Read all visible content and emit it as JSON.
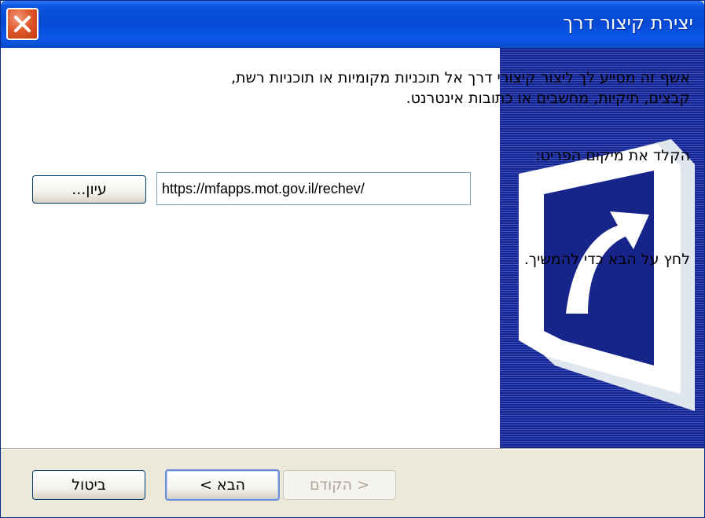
{
  "window": {
    "title": "יצירת קיצור דרך",
    "close_icon": "close-icon"
  },
  "main": {
    "intro_text": "אשף זה מסייע לך ליצור קיצורי דרך אל תוכניות מקומיות או תוכניות רשת, קבצים, תיקיות, מחשבים או כתובות אינטרנט.",
    "location_label": "הקלד את מיקום הפריט:",
    "location_value": "https://mfapps.mot.gov.il/rechev/",
    "browse_label": "עיון...",
    "continue_text": "לחץ על הבא כדי להמשיך."
  },
  "side_panel": {
    "icon": "shortcut-arrow-icon",
    "colors": {
      "dark": "#17258a",
      "light": "#3a52c8"
    }
  },
  "footer": {
    "back_label": "< הקודם",
    "next_label": "הבא >",
    "cancel_label": "ביטול"
  },
  "colors": {
    "titlebar": "#0648d4",
    "close_button": "#e05a2e",
    "dialog_background": "#ece9d8"
  }
}
